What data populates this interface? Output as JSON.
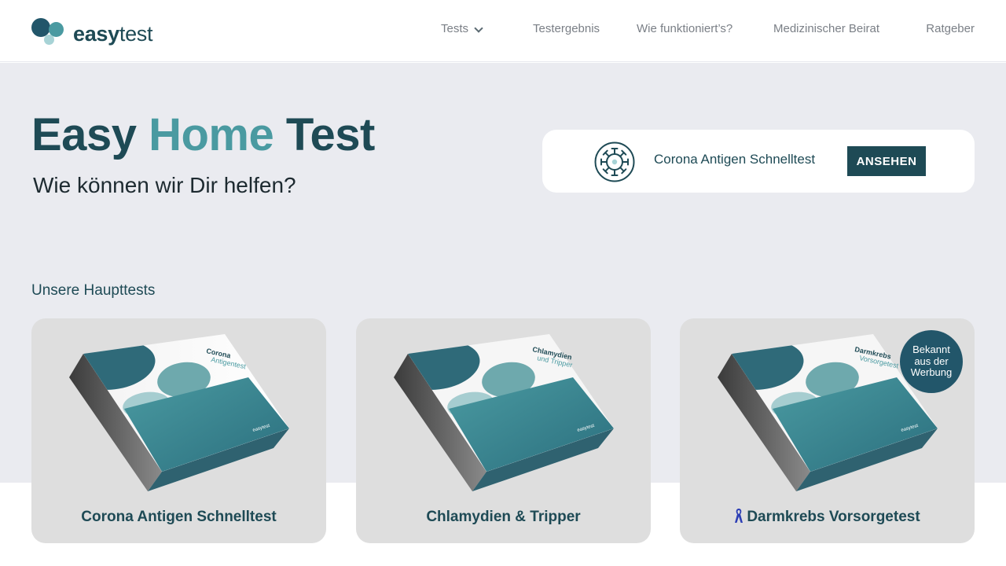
{
  "header": {
    "logo": {
      "bold": "easy",
      "regular": "test"
    },
    "nav": {
      "tests": "Tests",
      "ergebnis": "Testergebnis",
      "wie": "Wie funktioniert’s?",
      "beirat": "Medizinischer Beirat",
      "ratgeber": "Ratgeber"
    }
  },
  "hero": {
    "title_part1": "Easy ",
    "title_accent": "Home",
    "title_part2": " Test",
    "subtitle": "Wie können wir Dir helfen?"
  },
  "promo": {
    "icon": "virus-icon",
    "text": "Corona Antigen Schnelltest",
    "button": "ANSEHEN"
  },
  "section": {
    "label": "Unsere Haupttests"
  },
  "products": [
    {
      "title": "Corona Antigen Schnelltest",
      "box_line1": "Corona",
      "box_line2": "Antigentest",
      "box_brand": "easytest"
    },
    {
      "title": "Chlamydien & Tripper",
      "box_line1": "Chlamydien",
      "box_line2": "und Tripper",
      "box_brand": "easytest"
    },
    {
      "title": "Darmkrebs Vorsorgetest",
      "box_line1": "Darmkrebs",
      "box_line2": "Vorsorgetest",
      "box_brand": "easytest",
      "icon": "awareness-ribbon-icon",
      "badge": "Bekannt aus der Werbung"
    }
  ],
  "colors": {
    "primary": "#1e4a55",
    "accent": "#4a9aa1",
    "hero_bg": "#eaebf0",
    "card_bg": "#dedede"
  }
}
